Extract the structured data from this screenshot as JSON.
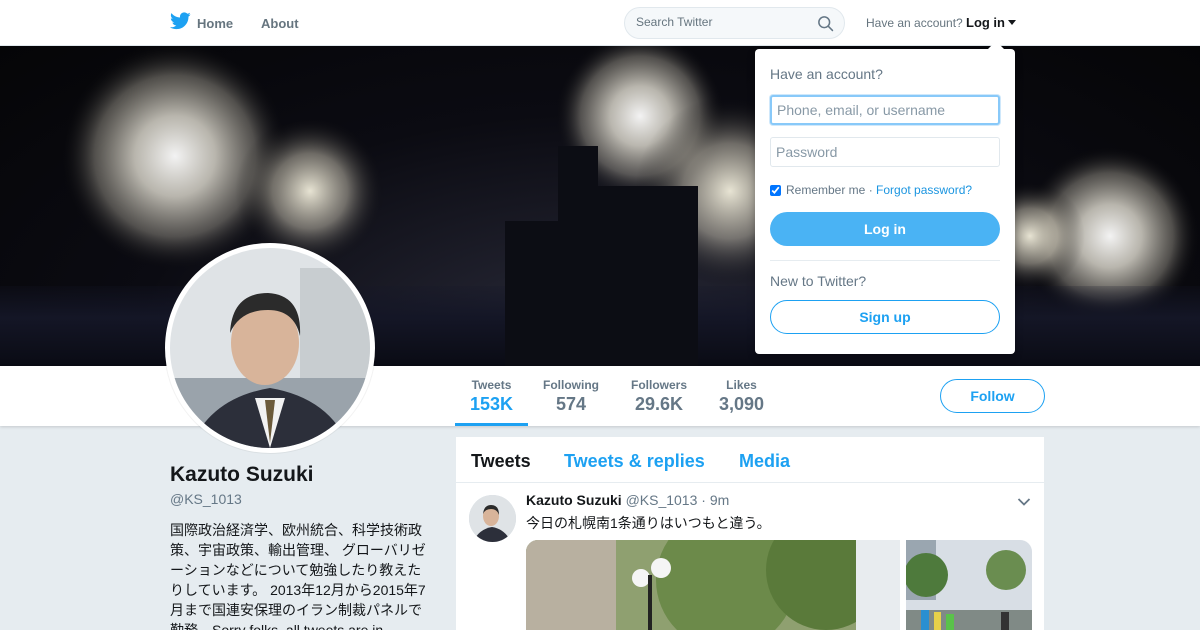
{
  "nav": {
    "home_label": "Home",
    "about_label": "About",
    "search_placeholder": "Search Twitter",
    "account_prompt": "Have an account?",
    "login_label": "Log in"
  },
  "profile": {
    "name": "Kazuto Suzuki",
    "handle": "@KS_1013",
    "bio": "国際政治経済学、欧州統合、科学技術政策、宇宙政策、輸出管理、 グローバリゼーションなどについて勉強したり教えたりしています。 2013年12月から2015年7月まで国連安保理のイラン制裁パネルで勤務。Sorry folks, all tweets are in"
  },
  "stats": [
    {
      "label": "Tweets",
      "value": "153K"
    },
    {
      "label": "Following",
      "value": "574"
    },
    {
      "label": "Followers",
      "value": "29.6K"
    },
    {
      "label": "Likes",
      "value": "3,090"
    }
  ],
  "follow_label": "Follow",
  "timeline": {
    "tabs": [
      "Tweets",
      "Tweets & replies",
      "Media"
    ],
    "tweet": {
      "name": "Kazuto Suzuki",
      "handle": "@KS_1013",
      "time": "· 9m",
      "text": "今日の札幌南1条通りはいつもと違う。"
    }
  },
  "login_dropdown": {
    "title": "Have an account?",
    "username_placeholder": "Phone, email, or username",
    "password_placeholder": "Password",
    "remember_label": "Remember me",
    "separator": " · ",
    "forgot_label": "Forgot password?",
    "login_button": "Log in",
    "new_prompt": "New to Twitter?",
    "signup_button": "Sign up"
  },
  "colors": {
    "accent": "#1da1f2",
    "login_button": "#4ab3f4",
    "background": "#e6ecf0"
  }
}
